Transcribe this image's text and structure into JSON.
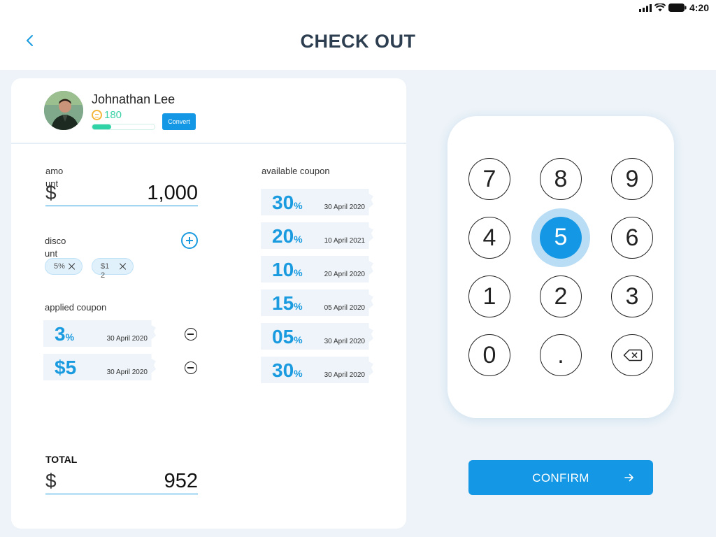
{
  "status_bar": {
    "time": "4:20"
  },
  "header": {
    "title": "CHECK OUT"
  },
  "user": {
    "name": "Johnathan Lee",
    "points": "180",
    "points_progress": 0.3,
    "convert_label": "Convert"
  },
  "amount": {
    "label": "amo\nunt",
    "currency": "$",
    "value": "1,000"
  },
  "discount": {
    "label": "disco\nunt",
    "chips": [
      {
        "label": "5%"
      },
      {
        "label": "$1\n2"
      }
    ]
  },
  "applied_coupon": {
    "label": "applied coupon",
    "items": [
      {
        "value": "3",
        "unit": "%",
        "date": "30 April 2020"
      },
      {
        "value": "$5",
        "unit": "",
        "date": "30 April 2020"
      }
    ]
  },
  "available_coupon": {
    "label": "available coupon",
    "items": [
      {
        "value": "30",
        "unit": "%",
        "date": "30 April 2020"
      },
      {
        "value": "20",
        "unit": "%",
        "date": "10 April 2021"
      },
      {
        "value": "10",
        "unit": "%",
        "date": "20 April 2020"
      },
      {
        "value": "15",
        "unit": "%",
        "date": "05 April 2020"
      },
      {
        "value": "05",
        "unit": "%",
        "date": "30 April 2020"
      },
      {
        "value": "30",
        "unit": "%",
        "date": "30 April 2020"
      }
    ]
  },
  "total": {
    "label": "TOTAL",
    "currency": "$",
    "value": "952"
  },
  "keypad": {
    "keys": [
      "7",
      "8",
      "9",
      "4",
      "5",
      "6",
      "1",
      "2",
      "3",
      "0",
      ".",
      "backspace"
    ],
    "active_key": "5"
  },
  "confirm": {
    "label": "CONFIRM"
  },
  "colors": {
    "accent": "#1497e4",
    "points": "#3dd1a8",
    "background": "#edf3f8"
  }
}
